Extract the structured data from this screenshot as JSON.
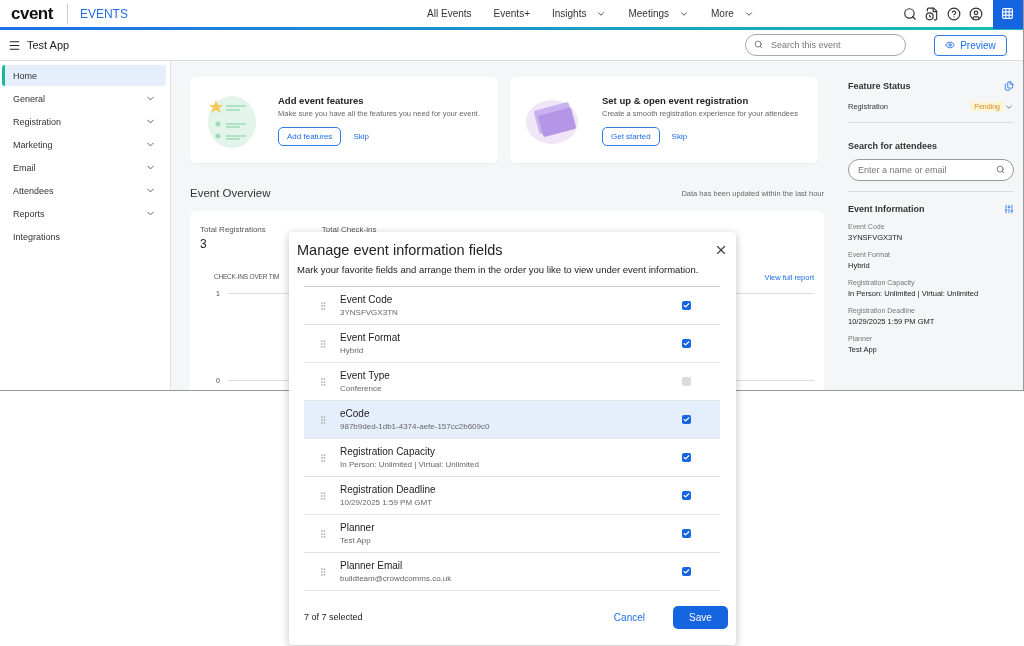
{
  "header": {
    "logo": "cvent",
    "product": "EVENTS",
    "nav": [
      {
        "label": "All Events",
        "dropdown": false
      },
      {
        "label": "Events+",
        "dropdown": false
      },
      {
        "label": "Insights",
        "dropdown": true
      },
      {
        "label": "Meetings",
        "dropdown": true
      },
      {
        "label": "More",
        "dropdown": true
      }
    ]
  },
  "subheader": {
    "app_name": "Test App",
    "search": {
      "placeholder": "Search this event"
    },
    "preview_button": "Preview"
  },
  "sidebar": {
    "items": [
      {
        "label": "Home",
        "selected": true,
        "expandable": false
      },
      {
        "label": "General",
        "selected": false,
        "expandable": true
      },
      {
        "label": "Registration",
        "selected": false,
        "expandable": true
      },
      {
        "label": "Marketing",
        "selected": false,
        "expandable": true
      },
      {
        "label": "Email",
        "selected": false,
        "expandable": true
      },
      {
        "label": "Attendees",
        "selected": false,
        "expandable": true
      },
      {
        "label": "Reports",
        "selected": false,
        "expandable": true
      },
      {
        "label": "Integrations",
        "selected": false,
        "expandable": false
      }
    ]
  },
  "cards": [
    {
      "kind": "features",
      "title": "Add event features",
      "description": "Make sure you have all the features you need for your event.",
      "button": "Add features",
      "link": "Skip"
    },
    {
      "kind": "registration",
      "title": "Set up & open event registration",
      "description": "Create a smooth registration experience for your attendees",
      "button": "Get started",
      "link": "Skip"
    }
  ],
  "overview": {
    "title": "Event Overview",
    "updated_note": "Data has been updated within the last hour",
    "stats": [
      {
        "label": "Total Registrations",
        "value": "3"
      },
      {
        "label": "Total Check-ins"
      }
    ],
    "chart_title": "CHECK-INS OVER TIM",
    "chart_link": "View full report",
    "y_labels": [
      "1",
      "0"
    ]
  },
  "right_panel": {
    "feature_status": {
      "title": "Feature Status",
      "rows": [
        {
          "label": "Registration",
          "status": "Pending"
        }
      ]
    },
    "attendee_search": {
      "title": "Search for attendees",
      "placeholder": "Enter a name or email"
    },
    "event_information": {
      "title": "Event Information",
      "fields": [
        {
          "label": "Event Code",
          "value": "3YNSFVGX3TN"
        },
        {
          "label": "Event Format",
          "value": "Hybrid"
        },
        {
          "label": "Registration Capacity",
          "value": "In Person: Unlimited | Virtual: Unlimited"
        },
        {
          "label": "Registration Deadline",
          "value": "10/29/2025 1:59 PM GMT"
        },
        {
          "label": "Planner",
          "value": "Test App"
        }
      ]
    }
  },
  "modal": {
    "title": "Manage event information fields",
    "description": "Mark your favorite fields and arrange them in the order you like to view under event information.",
    "fields": [
      {
        "label": "Event Code",
        "value": "3YNSFVGX3TN",
        "checked": true,
        "selected": false
      },
      {
        "label": "Event Format",
        "value": "Hybrid",
        "checked": true,
        "selected": false
      },
      {
        "label": "Event Type",
        "value": "Conference",
        "checked": false,
        "selected": false
      },
      {
        "label": "eCode",
        "value": "987b9ded-1db1-4374-aefe-157cc2b609c0",
        "checked": true,
        "selected": true
      },
      {
        "label": "Registration Capacity",
        "value": "In Person: Unlimited | Virtual: Unlimited",
        "checked": true,
        "selected": false
      },
      {
        "label": "Registration Deadline",
        "value": "10/29/2025 1:59 PM GMT",
        "checked": true,
        "selected": false
      },
      {
        "label": "Planner",
        "value": "Test App",
        "checked": true,
        "selected": false
      },
      {
        "label": "Planner Email",
        "value": "buildteam@crowdcomms.co.uk",
        "checked": true,
        "selected": false
      }
    ],
    "count": "7 of 7 selected",
    "cancel": "Cancel",
    "save": "Save"
  }
}
